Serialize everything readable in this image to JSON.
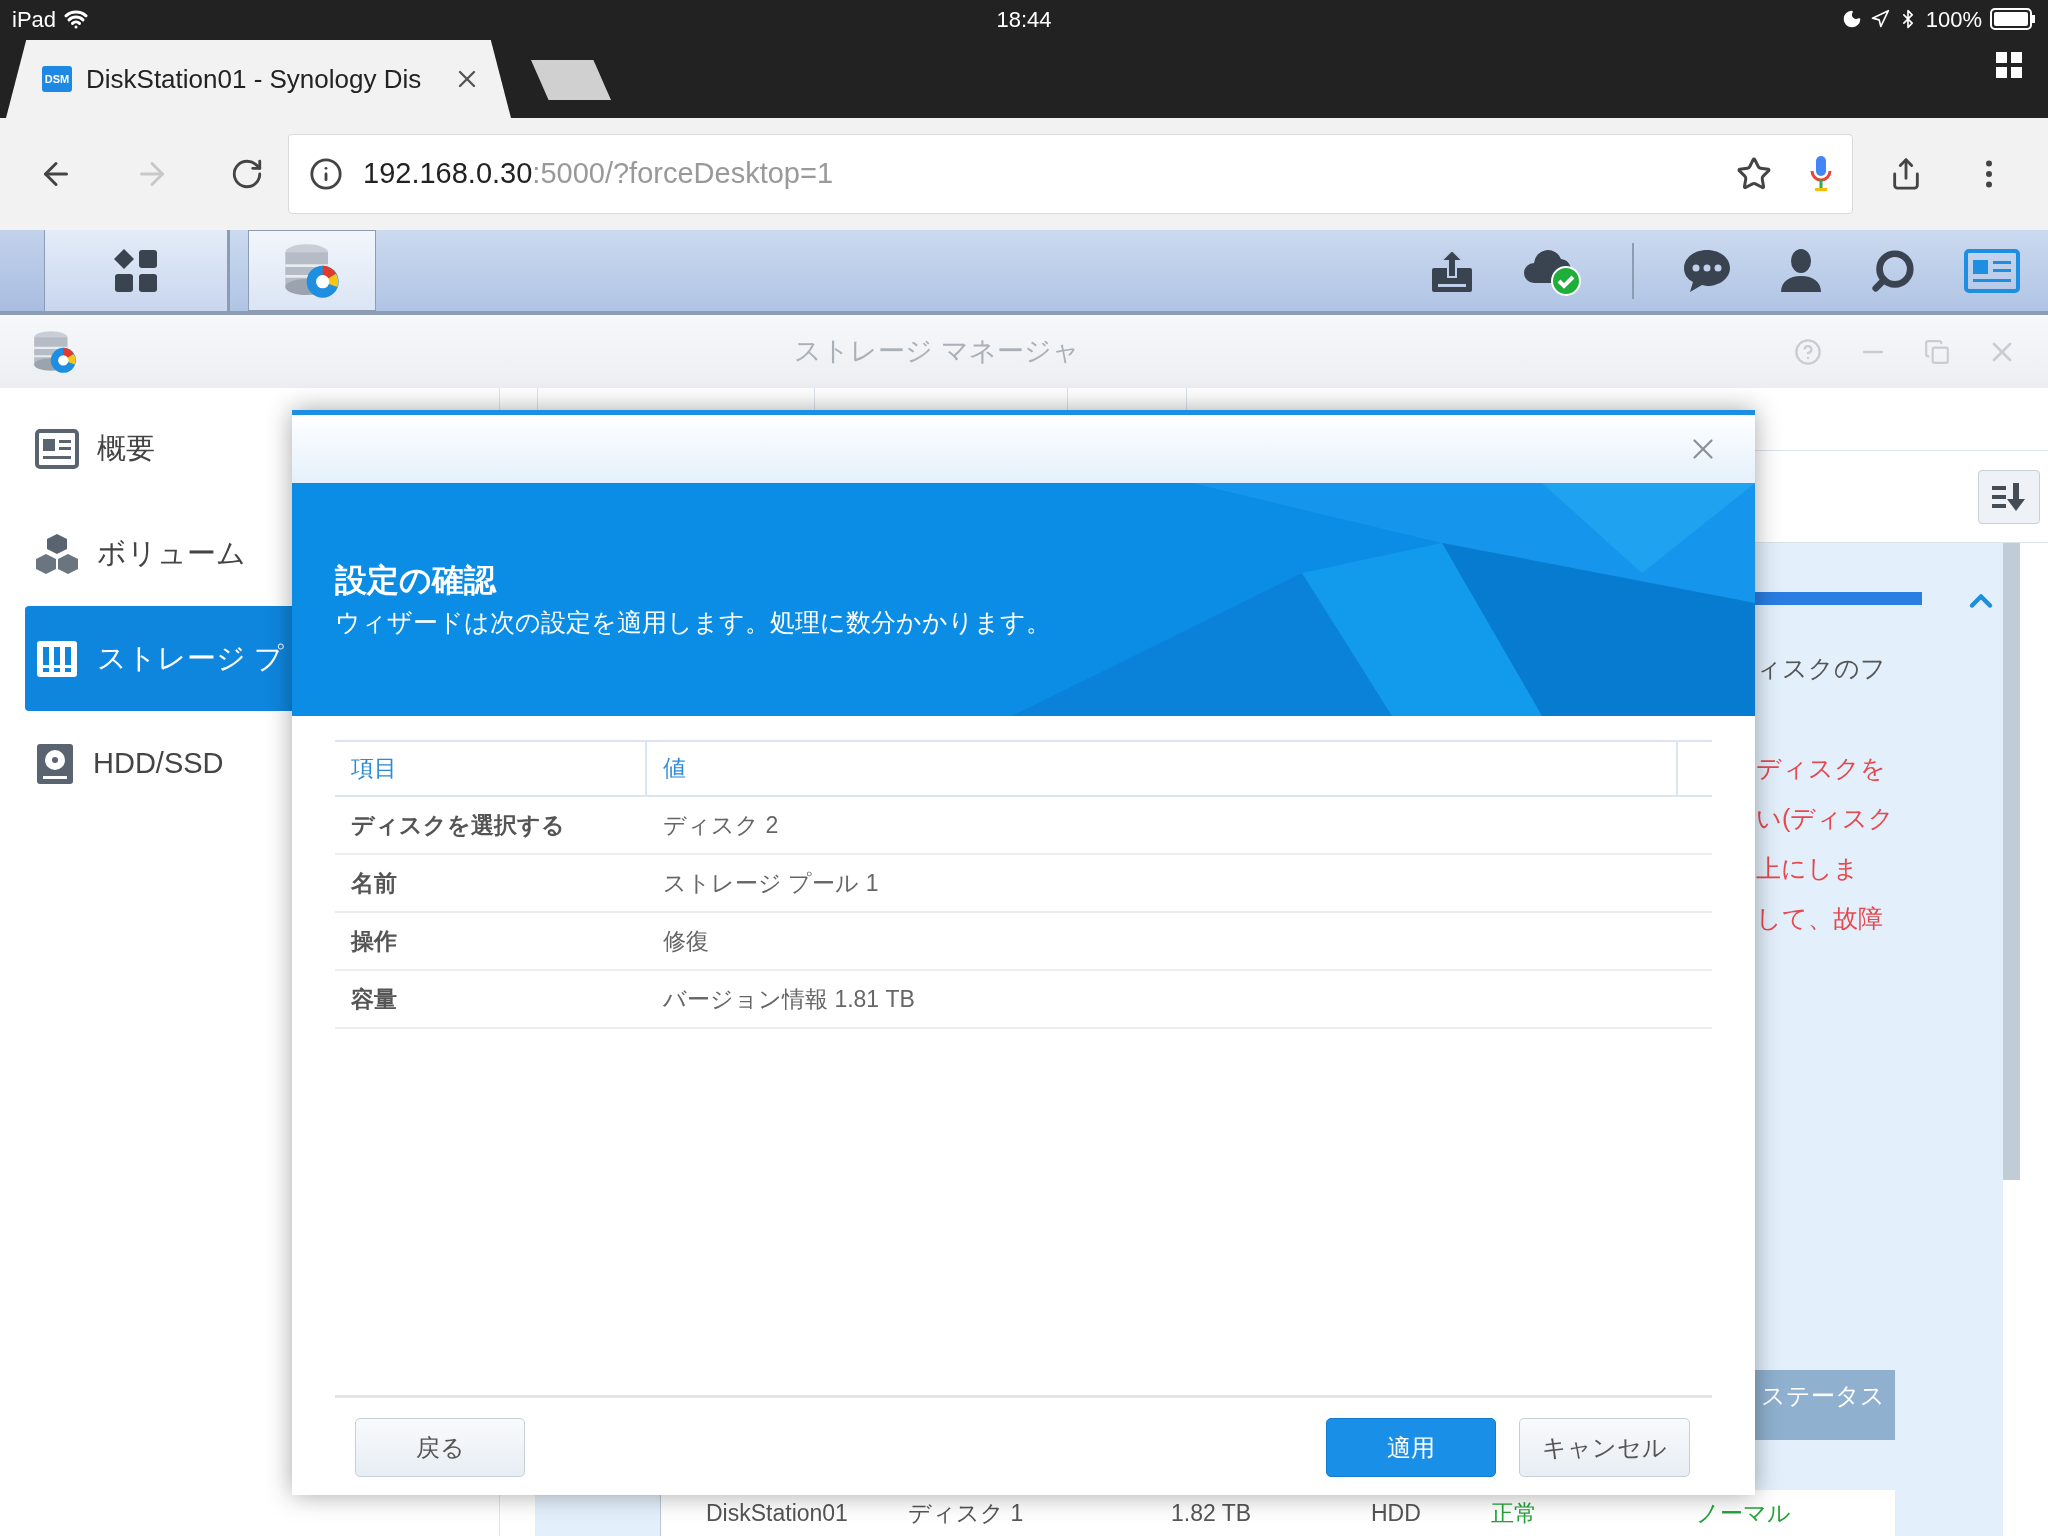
{
  "status_bar": {
    "device": "iPad",
    "time": "18:44",
    "battery": "100%"
  },
  "browser": {
    "tabs": [
      {
        "favicon": "DSM",
        "title": "DiskStation01 - Synology Dis",
        "selected": true
      }
    ],
    "forward_disabled": true,
    "address": {
      "host": "192.168.0.30",
      "path": ":5000/?forceDesktop=1"
    }
  },
  "window": {
    "title": "ストレージ マネージャ"
  },
  "sidebar": {
    "items": [
      {
        "label": "概要",
        "selected": false
      },
      {
        "label": "ボリューム",
        "selected": false
      },
      {
        "label": "ストレージ プ",
        "selected": true
      },
      {
        "label": "HDD/SSD",
        "selected": false
      }
    ]
  },
  "panel": {
    "lines": [
      {
        "text": "ィスクのフ",
        "kind": "normal"
      },
      {
        "text": "ディスクを",
        "kind": "warning"
      },
      {
        "text": "い(ディスク",
        "kind": "warning"
      },
      {
        "text": "上にしま",
        "kind": "warning"
      },
      {
        "text": "して、故障",
        "kind": "warning"
      }
    ],
    "disk_table": {
      "column_header": "ステータス",
      "row": [
        {
          "text": "DiskStation01",
          "kind": "plain"
        },
        {
          "text": "ディスク 1",
          "kind": "plain"
        },
        {
          "text": "1.82 TB",
          "kind": "plain"
        },
        {
          "text": "HDD",
          "kind": "plain"
        },
        {
          "text": "正常",
          "kind": "ok"
        },
        {
          "text": "ノーマル",
          "kind": "ok"
        }
      ]
    }
  },
  "dialog": {
    "title": "設定の確認",
    "subtitle": "ウィザードは次の設定を適用します。処理に数分かかります。",
    "table": {
      "columns": [
        "項目",
        "値"
      ],
      "rows": [
        {
          "item": "ディスクを選択する",
          "value": "ディスク 2"
        },
        {
          "item": "名前",
          "value": "ストレージ プール 1"
        },
        {
          "item": "操作",
          "value": "修復"
        },
        {
          "item": "容量",
          "value": "バージョン情報 1.81 TB"
        }
      ]
    },
    "footer": {
      "left": [
        {
          "label": "戻る",
          "kind": "secondary"
        }
      ],
      "right": [
        {
          "label": "適用",
          "kind": "primary"
        },
        {
          "label": "キャンセル",
          "kind": "secondary"
        }
      ]
    }
  }
}
